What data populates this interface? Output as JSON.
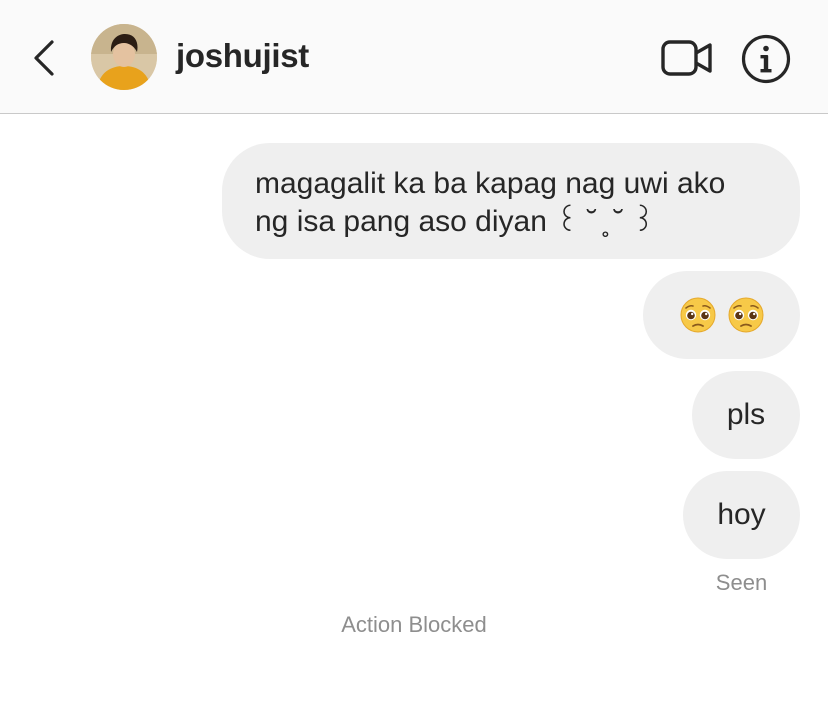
{
  "header": {
    "username": "joshujist",
    "back_icon": "chevron-left-icon",
    "video_icon": "video-camera-icon",
    "info_icon": "info-icon"
  },
  "messages": [
    {
      "line1": "magagalit ka ba kapag nag uwi ako",
      "line2": "ng isa pang aso diyan ꒰ ˘ ̥ ˘ ꒱"
    },
    {
      "emoji_1": "🥺",
      "emoji_2": "🥺"
    },
    {
      "text": "pls"
    },
    {
      "text": "hoy"
    }
  ],
  "status": {
    "seen": "Seen",
    "action_blocked": "Action Blocked"
  },
  "colors": {
    "bubble": "#efefef",
    "header_bg": "#fafafa",
    "muted_text": "#8e8e8e"
  }
}
